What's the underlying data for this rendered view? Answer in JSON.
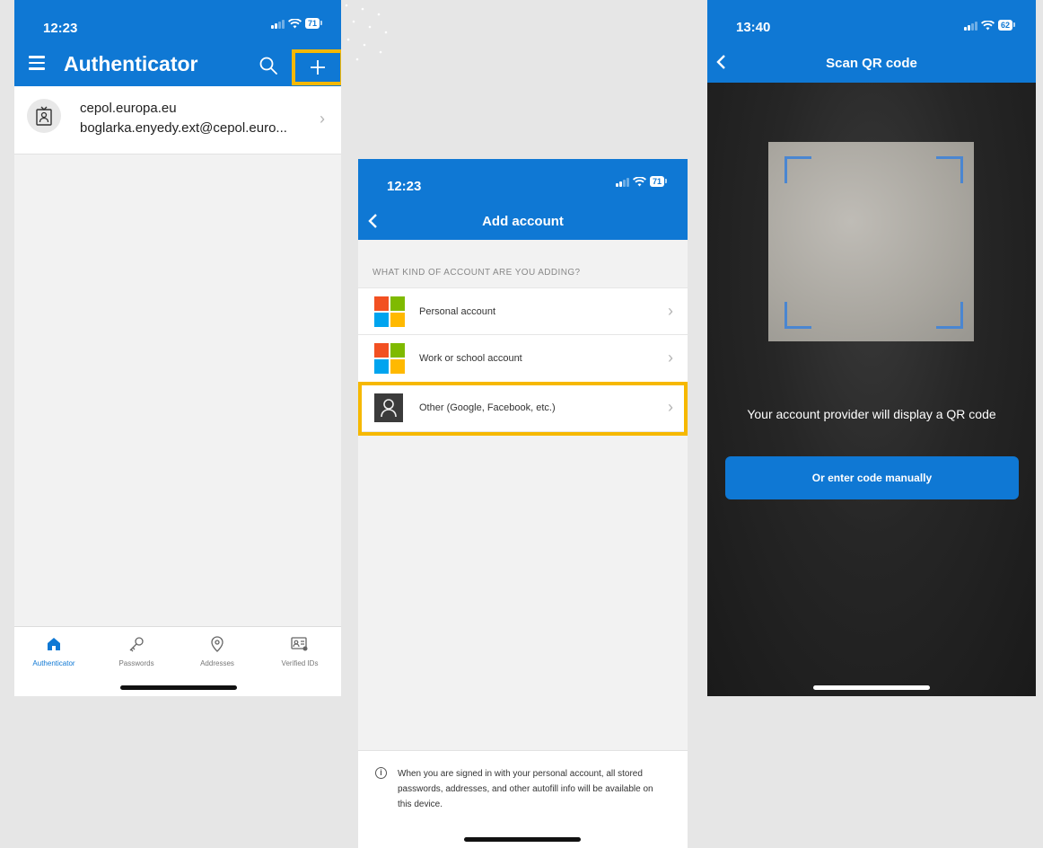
{
  "colors": {
    "accent": "#0f78d4",
    "highlight": "#f6b800",
    "background": "#e6e6e6"
  },
  "screen1": {
    "status_time": "12:23",
    "battery": "71",
    "title": "Authenticator",
    "icons": {
      "menu": "hamburger-menu-icon",
      "search": "search-icon",
      "add": "plus-icon"
    },
    "account": {
      "org": "cepol.europa.eu",
      "email": "boglarka.enyedy.ext@cepol.euro..."
    },
    "tabs": [
      {
        "label": "Authenticator",
        "icon": "home-icon",
        "active": true
      },
      {
        "label": "Passwords",
        "icon": "key-icon"
      },
      {
        "label": "Addresses",
        "icon": "location-pin-icon"
      },
      {
        "label": "Verified IDs",
        "icon": "id-card-icon"
      }
    ]
  },
  "screen2": {
    "status_time": "12:23",
    "battery": "71",
    "title": "Add account",
    "section_header": "WHAT KIND OF ACCOUNT ARE YOU ADDING?",
    "options": [
      {
        "label": "Personal account",
        "icon": "microsoft-logo-icon"
      },
      {
        "label": "Work or school account",
        "icon": "microsoft-logo-icon"
      },
      {
        "label": "Other (Google, Facebook, etc.)",
        "icon": "person-icon",
        "highlighted": true
      }
    ],
    "footer_note": "When you are signed in with your personal account, all stored passwords, addresses, and other autofill info will be available on this device."
  },
  "screen3": {
    "status_time": "13:40",
    "battery": "62",
    "title": "Scan QR code",
    "message": "Your account provider will display a QR code",
    "manual_button": "Or enter code manually"
  }
}
